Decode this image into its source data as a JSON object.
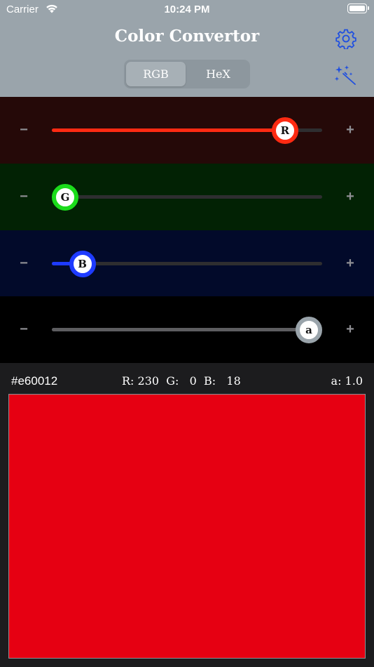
{
  "status_bar": {
    "carrier": "Carrier",
    "time": "10:24 PM"
  },
  "header": {
    "title": "Color Convertor",
    "settings_icon": "gear-icon",
    "magic_icon": "magic-wand-icon",
    "segments": [
      "RGB",
      "HeX"
    ],
    "selected_segment": "RGB"
  },
  "sliders": [
    {
      "label": "R",
      "value": 230,
      "max": 255,
      "minus": "−",
      "plus": "+",
      "row_bg": "#250908",
      "fill": "#ff2a12",
      "knob_border": "#ff2a12"
    },
    {
      "label": "G",
      "value": 0,
      "max": 255,
      "minus": "−",
      "plus": "+",
      "row_bg": "#022204",
      "fill": "#1bdc1b",
      "knob_border": "#1bdc1b"
    },
    {
      "label": "B",
      "value": 18,
      "max": 255,
      "minus": "−",
      "plus": "+",
      "row_bg": "#020a2a",
      "fill": "#1e3bff",
      "knob_border": "#1e3bff"
    },
    {
      "label": "a",
      "value": 1.0,
      "max": 1.0,
      "minus": "−",
      "plus": "+",
      "row_bg": "#000000",
      "fill": "#5d5d60",
      "knob_border": "#9aa4ab"
    }
  ],
  "info": {
    "hex": "#e60012",
    "rgb_text": "R: 230  G:   0  B:   18",
    "alpha_text": "a: 1.0"
  },
  "preview": {
    "color": "#e60012"
  }
}
